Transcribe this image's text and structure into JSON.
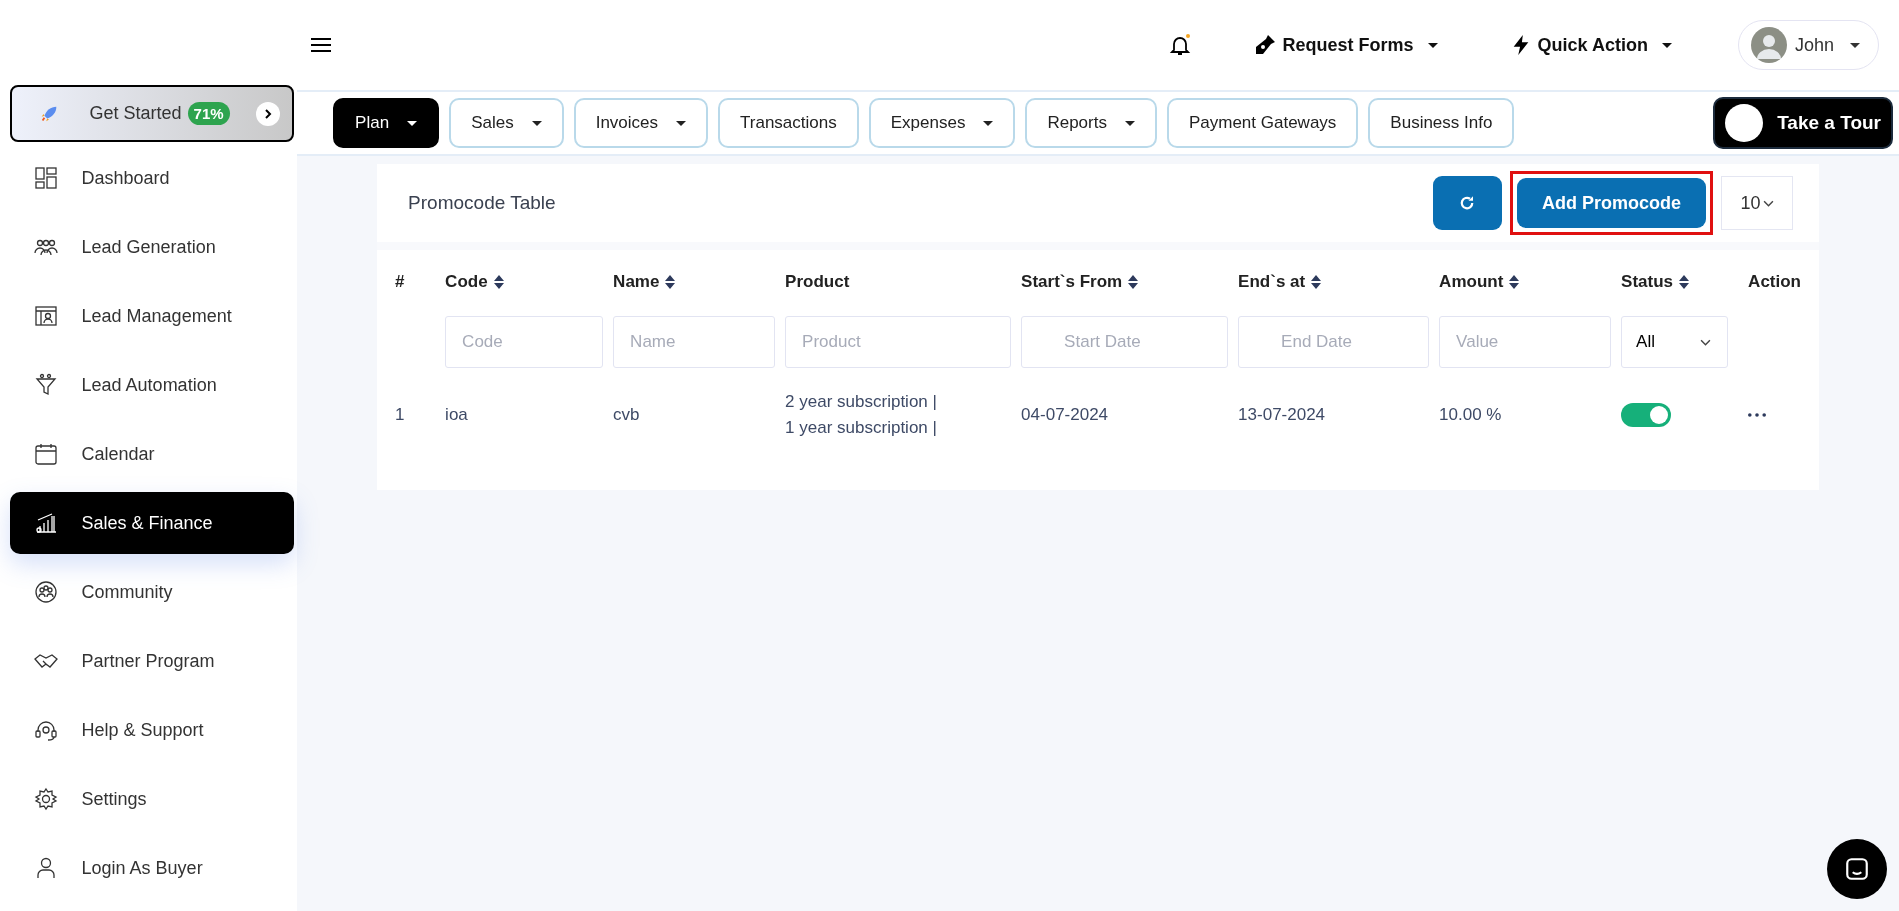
{
  "get_started": {
    "label": "Get Started",
    "badge": "71%"
  },
  "sidebar": {
    "items": [
      {
        "label": "Dashboard",
        "selected": false
      },
      {
        "label": "Lead Generation",
        "selected": false
      },
      {
        "label": "Lead Management",
        "selected": false
      },
      {
        "label": "Lead Automation",
        "selected": false
      },
      {
        "label": "Calendar",
        "selected": false
      },
      {
        "label": "Sales & Finance",
        "selected": true
      },
      {
        "label": "Community",
        "selected": false
      },
      {
        "label": "Partner Program",
        "selected": false
      },
      {
        "label": "Help & Support",
        "selected": false
      },
      {
        "label": "Settings",
        "selected": false
      },
      {
        "label": "Login As Buyer",
        "selected": false
      }
    ]
  },
  "topbar": {
    "request_forms": "Request Forms",
    "quick_action": "Quick Action",
    "user": "John",
    "notification_dot": true
  },
  "tabs": [
    {
      "label": "Plan",
      "selected": true,
      "dropdown": true
    },
    {
      "label": "Sales",
      "selected": false,
      "dropdown": true
    },
    {
      "label": "Invoices",
      "selected": false,
      "dropdown": true
    },
    {
      "label": "Transactions",
      "selected": false,
      "dropdown": false
    },
    {
      "label": "Expenses",
      "selected": false,
      "dropdown": true
    },
    {
      "label": "Reports",
      "selected": false,
      "dropdown": true
    },
    {
      "label": "Payment Gateways",
      "selected": false,
      "dropdown": false
    },
    {
      "label": "Business Info",
      "selected": false,
      "dropdown": false
    }
  ],
  "tour_button": "Take a Tour",
  "card": {
    "title": "Promocode Table",
    "add_button": "Add Promocode",
    "page_size": "10"
  },
  "table": {
    "columns": [
      {
        "label": "#",
        "sortable": false
      },
      {
        "label": "Code",
        "sortable": true
      },
      {
        "label": "Name",
        "sortable": true
      },
      {
        "label": "Product",
        "sortable": false
      },
      {
        "label": "Start`s From",
        "sortable": true
      },
      {
        "label": "End`s at",
        "sortable": true
      },
      {
        "label": "Amount",
        "sortable": true
      },
      {
        "label": "Status",
        "sortable": true
      },
      {
        "label": "Action",
        "sortable": false
      }
    ],
    "filters": [
      {
        "kind": "none"
      },
      {
        "kind": "text",
        "placeholder": "Code"
      },
      {
        "kind": "text",
        "placeholder": "Name"
      },
      {
        "kind": "text",
        "placeholder": "Product"
      },
      {
        "kind": "date",
        "placeholder": "Start Date"
      },
      {
        "kind": "date",
        "placeholder": "End Date"
      },
      {
        "kind": "text",
        "placeholder": "Value"
      },
      {
        "kind": "select",
        "value": "All"
      },
      {
        "kind": "none"
      }
    ],
    "rows": [
      {
        "index": "1",
        "code": "ioa",
        "name": "cvb",
        "products": [
          "2 year subscription |",
          "1 year subscription |"
        ],
        "start": "04-07-2024",
        "end": "13-07-2024",
        "amount": "10.00 %",
        "active": true
      }
    ]
  }
}
